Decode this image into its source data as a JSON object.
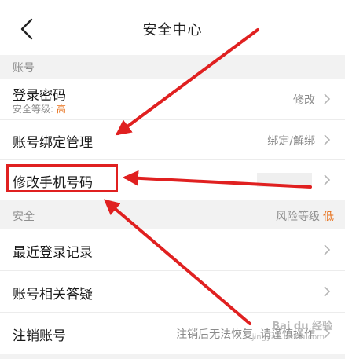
{
  "header": {
    "title": "安全中心",
    "back_icon": "chevron-left-icon"
  },
  "sections": {
    "account": {
      "label": "账号"
    },
    "security": {
      "label": "安全",
      "risk_label": "风险等级",
      "risk_value": "低"
    }
  },
  "rows": {
    "login_password": {
      "title": "登录密码",
      "sub_prefix": "安全等级: ",
      "sub_value": "高",
      "action": "修改"
    },
    "binding": {
      "title": "账号绑定管理",
      "action": "绑定/解绑"
    },
    "change_phone": {
      "title": "修改手机号码"
    },
    "recent_login": {
      "title": "最近登录记录"
    },
    "account_qa": {
      "title": "账号相关答疑"
    },
    "cancel_account": {
      "title": "注销账号",
      "action": "注销后无法恢复, 请谨慎操作"
    }
  },
  "watermark": {
    "brand": "Bai du 经验",
    "url": "jingyan.baidu.com"
  },
  "colors": {
    "accent": "#e8701a",
    "annotation": "#e02020"
  }
}
